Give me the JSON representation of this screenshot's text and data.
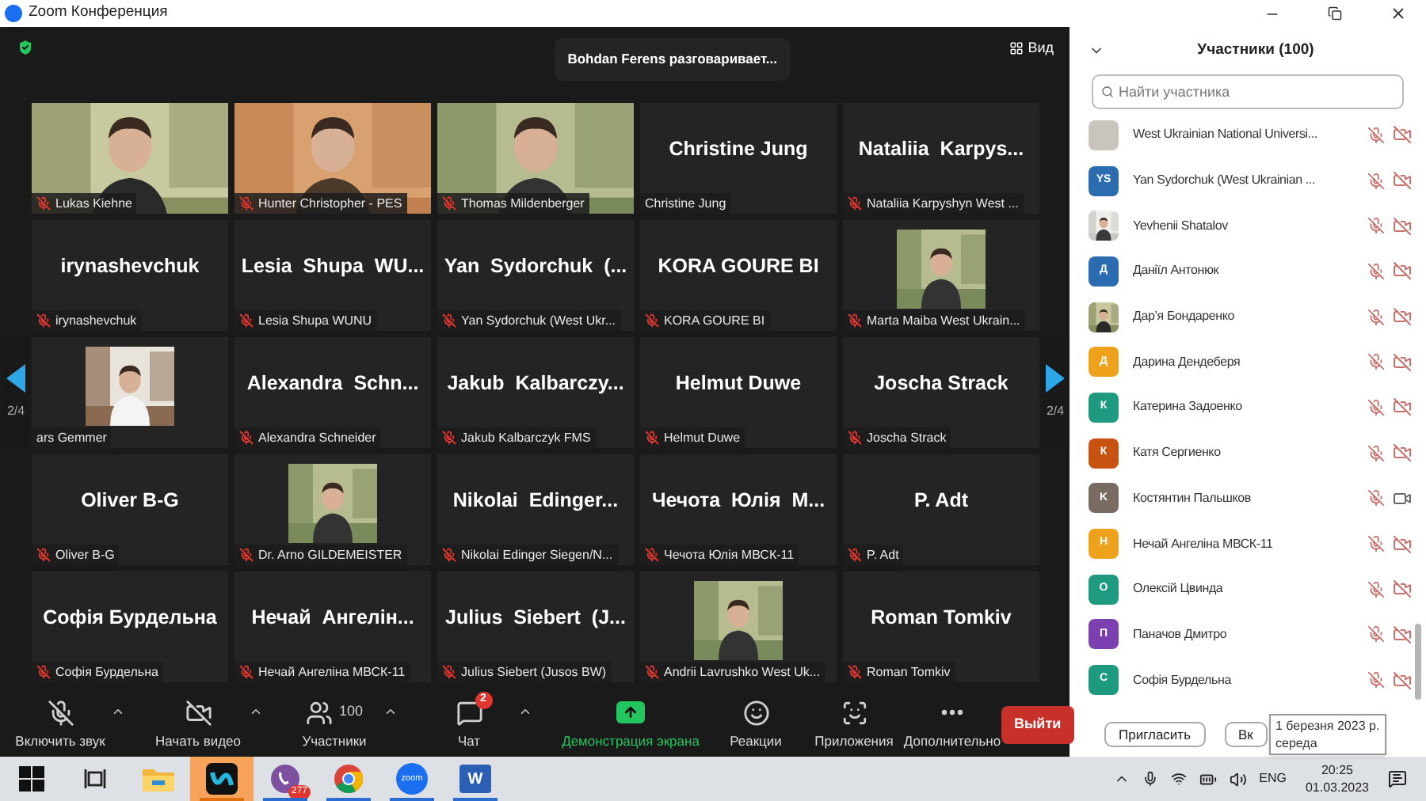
{
  "window": {
    "title": "Zoom Конференция"
  },
  "meeting": {
    "speaker_toast": "Bohdan Ferens разговаривает...",
    "view_label": "Вид",
    "pager_left": "2/4",
    "pager_right": "2/4"
  },
  "tiles": [
    {
      "kind": "video",
      "label": "Lukas Kiehne",
      "muted": true
    },
    {
      "kind": "video",
      "label": "Hunter Christopher - PES",
      "muted": true
    },
    {
      "kind": "video",
      "label": "Thomas Mildenberger",
      "muted": true
    },
    {
      "kind": "name",
      "title": "Christine Jung",
      "label": "Christine Jung",
      "muted": false
    },
    {
      "kind": "name",
      "title": "Nataliia  Karpys...",
      "label": "Nataliia Karpyshyn West ...",
      "muted": true
    },
    {
      "kind": "name",
      "title": "irynashevchuk",
      "label": "irynashevchuk",
      "muted": true
    },
    {
      "kind": "name",
      "title": "Lesia  Shupa  WU...",
      "label": "Lesia Shupa WUNU",
      "muted": true
    },
    {
      "kind": "name",
      "title": "Yan  Sydorchuk  (...",
      "label": "Yan Sydorchuk (West Ukr...",
      "muted": true
    },
    {
      "kind": "name",
      "title": "KORA GOURE BI",
      "label": "KORA GOURE BI",
      "muted": true
    },
    {
      "label": "Marta Maiba West Ukrain...",
      "muted": true
    },
    {
      "label": "ars Gemmer",
      "muted": false
    },
    {
      "kind": "name",
      "title": "Alexandra  Schn...",
      "label": "Alexandra Schneider",
      "muted": true
    },
    {
      "kind": "name",
      "title": "Jakub  Kalbarczy...",
      "label": "Jakub Kalbarczyk FMS",
      "muted": true
    },
    {
      "kind": "name",
      "title": "Helmut Duwe",
      "label": "Helmut Duwe",
      "muted": true
    },
    {
      "kind": "name",
      "title": "Joscha Strack",
      "label": "Joscha Strack",
      "muted": true
    },
    {
      "kind": "name",
      "title": "Oliver B-G",
      "label": "Oliver B-G",
      "muted": true
    },
    {
      "label": "Dr. Arno GILDEMEISTER",
      "muted": true
    },
    {
      "kind": "name",
      "title": "Nikolai  Edinger...",
      "label": "Nikolai Edinger Siegen/N...",
      "muted": true
    },
    {
      "kind": "name",
      "title": "Чечота  Юлія  М...",
      "label": "Чечота Юлія МВСК-11",
      "muted": true
    },
    {
      "kind": "name",
      "title": "P. Adt",
      "label": "P. Adt",
      "muted": true
    },
    {
      "kind": "name",
      "title": "Софія Бурдельна",
      "label": "Софія Бурдельна",
      "muted": true
    },
    {
      "kind": "name",
      "title": "Нечай  Ангелін...",
      "label": "Нечай Ангеліна МВСК-11",
      "muted": true
    },
    {
      "kind": "name",
      "title": "Julius  Siebert  (J...",
      "label": "Julius Siebert (Jusos BW)",
      "muted": true
    },
    {
      "label": "Andrii Lavrushko West Uk...",
      "muted": true
    },
    {
      "kind": "name",
      "title": "Roman Tomkiv",
      "label": "Roman Tomkiv",
      "muted": true
    }
  ],
  "toolbar": {
    "items": [
      {
        "kind": "audio",
        "label": "Включить звук",
        "muted": true
      },
      {
        "kind": "video",
        "label": "Начать видео",
        "off": true
      },
      {
        "kind": "participants",
        "label": "Участники",
        "count": "100"
      },
      {
        "kind": "chat",
        "label": "Чат",
        "badge": "2"
      },
      {
        "kind": "share",
        "label": "Демонстрация экрана"
      },
      {
        "kind": "reactions",
        "label": "Реакции"
      },
      {
        "kind": "apps",
        "label": "Приложения"
      },
      {
        "kind": "more",
        "label": "Дополнительно"
      }
    ],
    "leave": "Выйти"
  },
  "participants": {
    "title": "Участники (100)",
    "search": {
      "placeholder": "Найти участника"
    },
    "items": [
      {
        "name": "West Ukrainian National Universi...",
        "avatar": {
          "kind": "blank",
          "color": "#c9c4bc"
        },
        "mic_muted": true,
        "video_off": true
      },
      {
        "name": "Yan Sydorchuk (West Ukrainian ...",
        "avatar": {
          "kind": "initials",
          "text": "YS",
          "color": "#2b6cb0"
        },
        "mic_muted": true,
        "video_off": true
      },
      {
        "name": "Yevhenii Shatalov",
        "mic_muted": true,
        "video_off": true
      },
      {
        "name": "Даніїл Антонюк",
        "avatar": {
          "kind": "initials",
          "text": "Д",
          "color": "#2b6cb0"
        },
        "mic_muted": true,
        "video_off": true
      },
      {
        "name": "Дар’я Бондаренко",
        "mic_muted": true,
        "video_off": true
      },
      {
        "name": "Дарина Дендеберя",
        "avatar": {
          "kind": "initials",
          "text": "Д",
          "color": "#eea21b"
        },
        "mic_muted": true,
        "video_off": true
      },
      {
        "name": "Катерина Задоенко",
        "avatar": {
          "kind": "initials",
          "text": "К",
          "color": "#1e9a80"
        },
        "mic_muted": true,
        "video_off": true
      },
      {
        "name": "Катя Сергиенко",
        "avatar": {
          "kind": "initials",
          "text": "К",
          "color": "#c8520f"
        },
        "mic_muted": true,
        "video_off": true
      },
      {
        "name": "Костянтин Пальшков",
        "avatar": {
          "kind": "initials",
          "text": "K",
          "color": "#7a6b62"
        },
        "mic_muted": true,
        "video_off": false
      },
      {
        "name": "Нечай Ангеліна МВСК-11",
        "avatar": {
          "kind": "initials",
          "text": "Н",
          "color": "#eea21b"
        },
        "mic_muted": true,
        "video_off": true
      },
      {
        "name": "Олексій Цвинда",
        "avatar": {
          "kind": "initials",
          "text": "О",
          "color": "#1e9a80"
        },
        "mic_muted": true,
        "video_off": true
      },
      {
        "name": "Паначов Дмитро",
        "avatar": {
          "kind": "initials",
          "text": "П",
          "color": "#7b3fb0"
        },
        "mic_muted": true,
        "video_off": true
      },
      {
        "name": "Софія Бурдельна",
        "avatar": {
          "kind": "initials",
          "text": "С",
          "color": "#1e9a80"
        },
        "mic_muted": true,
        "video_off": true
      }
    ],
    "buttons": [
      "Пригласить",
      "Вк"
    ]
  },
  "tooltip": {
    "lines": [
      "1 березня 2023 р.",
      "середа"
    ]
  },
  "taskbar": {
    "apps": [
      {
        "kind": "start",
        "active": false,
        "running": false
      },
      {
        "kind": "task-view",
        "active": false,
        "running": false
      },
      {
        "kind": "explorer",
        "active": false,
        "running": false
      },
      {
        "kind": "webex",
        "active": true,
        "running": true
      },
      {
        "kind": "viber",
        "badge": "277",
        "active": false,
        "running": true
      },
      {
        "kind": "chrome",
        "active": false,
        "running": true
      },
      {
        "kind": "zoom",
        "label": "zoom",
        "active": false,
        "running": true
      },
      {
        "kind": "word",
        "label": "W",
        "active": false,
        "running": true
      }
    ],
    "tray": {
      "language": "ENG",
      "time": "20:25",
      "date": "01.03.2023"
    }
  }
}
